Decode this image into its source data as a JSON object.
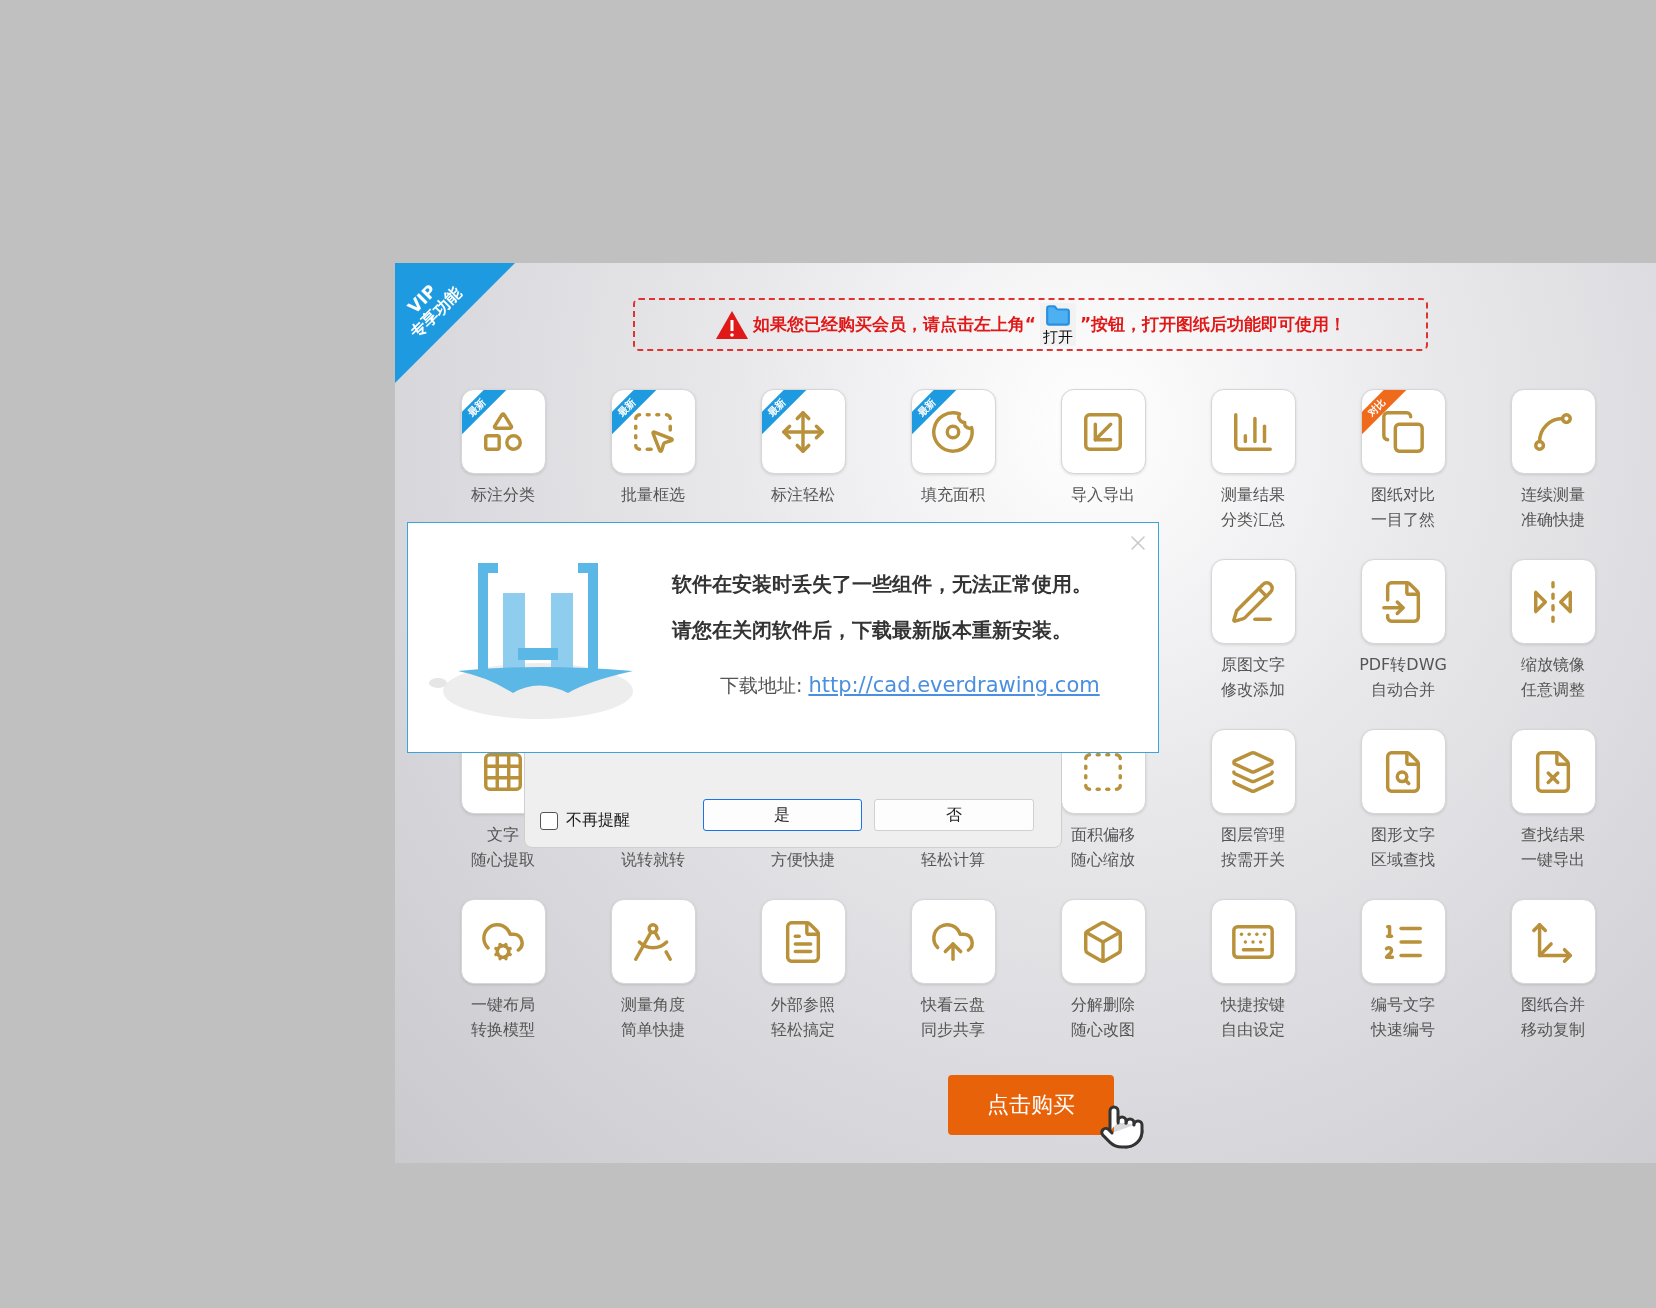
{
  "vip_ribbon": {
    "line1": "VIP",
    "line2": "专享功能"
  },
  "notice": {
    "before": "如果您已经购买会员，请点击左上角“",
    "open_label": "打开",
    "after": "”按钮，打开图纸后功能即可使用！"
  },
  "feature_rows": [
    {
      "tiles": [
        {
          "icon_shown": true,
          "badge": {
            "text": "最新",
            "color": "#1e9be0"
          },
          "label_top": "标注分类"
        },
        {
          "icon_shown": true,
          "badge": {
            "text": "最新",
            "color": "#1e9be0"
          },
          "label_top": "批量框选"
        },
        {
          "icon_shown": true,
          "badge": {
            "text": "最新",
            "color": "#1e9be0"
          },
          "label_top": "标注轻松"
        },
        {
          "icon_shown": true,
          "badge": {
            "text": "最新",
            "color": "#1e9be0"
          },
          "label_top": "填充面积"
        },
        {
          "icon_shown": true,
          "label_top": "导入导出"
        },
        {
          "icon_shown": true,
          "label_top": "测量结果",
          "label_bottom": "分类汇总"
        },
        {
          "icon_shown": true,
          "badge": {
            "text": "对比",
            "color": "#f06a1c"
          },
          "label_top": "图纸对比",
          "label_bottom": "一目了然"
        },
        {
          "icon_shown": true,
          "label_top": "连续测量",
          "label_bottom": "准确快捷"
        }
      ]
    },
    {
      "tiles": [
        {
          "icon_shown": true,
          "label_top": "原图文字",
          "label_bottom": "修改添加"
        },
        {
          "icon_shown": true,
          "label_top": "PDF转DWG",
          "label_bottom": "自动合并"
        },
        {
          "icon_shown": true,
          "label_top": "缩放镜像",
          "label_bottom": "任意调整"
        }
      ]
    },
    {
      "tiles": [
        {
          "icon_shown": true,
          "label_top": "文字",
          "label_bottom": "随心提取"
        },
        {
          "icon_shown": false,
          "label_bottom": "说转就转"
        },
        {
          "icon_shown": false,
          "label_bottom": "方便快捷"
        },
        {
          "icon_shown": false,
          "label_bottom": "轻松计算"
        },
        {
          "icon_shown": true,
          "label_top": "面积偏移",
          "label_bottom": "随心缩放"
        },
        {
          "icon_shown": true,
          "label_top": "图层管理",
          "label_bottom": "按需开关"
        },
        {
          "icon_shown": true,
          "label_top": "图形文字",
          "label_bottom": "区域查找"
        },
        {
          "icon_shown": true,
          "label_top": "查找结果",
          "label_bottom": "一键导出"
        }
      ]
    },
    {
      "tiles": [
        {
          "icon_shown": true,
          "label_top": "一键布局",
          "label_bottom": "转换模型"
        },
        {
          "icon_shown": true,
          "label_top": "测量角度",
          "label_bottom": "简单快捷"
        },
        {
          "icon_shown": true,
          "label_top": "外部参照",
          "label_bottom": "轻松搞定"
        },
        {
          "icon_shown": true,
          "label_top": "快看云盘",
          "label_bottom": "同步共享"
        },
        {
          "icon_shown": true,
          "label_top": "分解删除",
          "label_bottom": "随心改图"
        },
        {
          "icon_shown": true,
          "label_top": "快捷按键",
          "label_bottom": "自由设定"
        },
        {
          "icon_shown": true,
          "label_top": "编号文字",
          "label_bottom": "快速编号"
        },
        {
          "icon_shown": true,
          "label_top": "图纸合并",
          "label_bottom": "移动复制"
        }
      ]
    }
  ],
  "error_dialog": {
    "lines": [
      "软件在安装时丢失了一些组件，无法正常使用。",
      "请您在关闭软件后，下载最新版本重新安装。"
    ],
    "download_label": "下载地址:",
    "download_link": "http://cad.everdrawing.com"
  },
  "confirm_dialog": {
    "checkbox": {
      "label": "不再提醒",
      "checked": false
    },
    "buttons": [
      {
        "label": "是",
        "selected": true
      },
      {
        "label": "否",
        "selected": false
      }
    ]
  },
  "buy_button": "点击购买"
}
